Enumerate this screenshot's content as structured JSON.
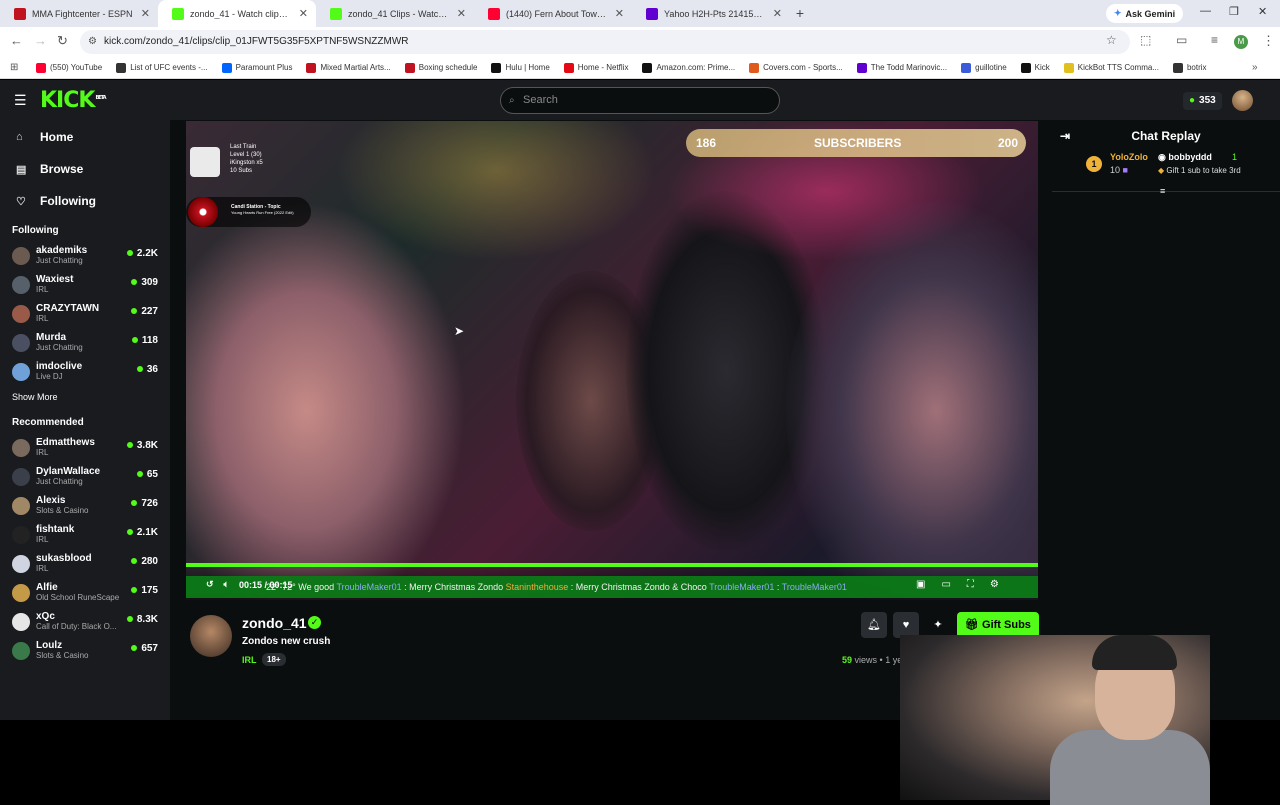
{
  "browser": {
    "tabs": [
      {
        "label": "MMA Fightcenter - ESPN",
        "color": "#c1121f",
        "active": false
      },
      {
        "label": "zondo_41 - Watch clips on Kick",
        "color": "#53fc18",
        "active": true
      },
      {
        "label": "zondo_41 Clips - Watch Live on",
        "color": "#53fc18",
        "active": false
      },
      {
        "label": "(1440) Fern About Town - YouTu",
        "color": "#ff0033",
        "active": false
      },
      {
        "label": "Yahoo H2H-Pts 214155 - Mr. Bo",
        "color": "#6001d2",
        "active": false
      }
    ],
    "gemini_label": "Ask Gemini",
    "url": "kick.com/zondo_41/clips/clip_01JFWT5G35F5XPTNF5WSNZZMWR",
    "bookmarks": [
      {
        "label": "(550) YouTube",
        "color": "#ff0033"
      },
      {
        "label": "List of UFC events -...",
        "color": "#333333"
      },
      {
        "label": "Paramount Plus",
        "color": "#0064ff"
      },
      {
        "label": "Mixed Martial Arts...",
        "color": "#c1121f"
      },
      {
        "label": "Boxing schedule",
        "color": "#c1121f"
      },
      {
        "label": "Hulu | Home",
        "color": "#111111"
      },
      {
        "label": "Home - Netflix",
        "color": "#e50914"
      },
      {
        "label": "Amazon.com: Prime...",
        "color": "#111111"
      },
      {
        "label": "Covers.com - Sports...",
        "color": "#e05a1c"
      },
      {
        "label": "The Todd Marinovic...",
        "color": "#6001d2"
      },
      {
        "label": "guillotine",
        "color": "#3b5bdb"
      },
      {
        "label": "Kick",
        "color": "#111111"
      },
      {
        "label": "KickBot TTS Comma...",
        "color": "#e0c020"
      },
      {
        "label": "botrix",
        "color": "#333333"
      }
    ]
  },
  "kick": {
    "logo": "KICK",
    "logo_beta": "BETA",
    "search_placeholder": "Search",
    "points": "353",
    "nav": [
      {
        "label": "Home",
        "icon": "home-icon",
        "glyph": "⌂"
      },
      {
        "label": "Browse",
        "icon": "browse-icon",
        "glyph": "▤"
      },
      {
        "label": "Following",
        "icon": "heart-icon",
        "glyph": "♡"
      }
    ],
    "following_header": "Following",
    "following": [
      {
        "name": "akademiks",
        "category": "Just Chatting",
        "viewers": "2.2K",
        "color": "#6b5a50"
      },
      {
        "name": "Waxiest",
        "category": "IRL",
        "viewers": "309",
        "color": "#55606a"
      },
      {
        "name": "CRAZYTAWN",
        "category": "IRL",
        "viewers": "227",
        "color": "#9a5a4a"
      },
      {
        "name": "Murda",
        "category": "Just Chatting",
        "viewers": "118",
        "color": "#4a4f62"
      },
      {
        "name": "imdoclive",
        "category": "Live DJ",
        "viewers": "36",
        "color": "#6fa1d8"
      }
    ],
    "show_more": "Show More",
    "recommended_header": "Recommended",
    "recommended": [
      {
        "name": "Edmatthews",
        "category": "IRL",
        "viewers": "3.8K",
        "color": "#7a6a5e"
      },
      {
        "name": "DylanWallace",
        "category": "Just Chatting",
        "viewers": "65",
        "color": "#3a3f4a"
      },
      {
        "name": "Alexis",
        "category": "Slots & Casino",
        "viewers": "726",
        "color": "#a08866"
      },
      {
        "name": "fishtank",
        "category": "IRL",
        "viewers": "2.1K",
        "color": "#222222"
      },
      {
        "name": "sukasblood",
        "category": "IRL",
        "viewers": "280",
        "color": "#d0d4e0"
      },
      {
        "name": "Alfie",
        "category": "Old School RuneScape",
        "viewers": "175",
        "color": "#c49a48"
      },
      {
        "name": "xQc",
        "category": "Call of Duty: Black O...",
        "viewers": "8.3K",
        "color": "#e6e6e6"
      },
      {
        "name": "Loulz",
        "category": "Slots & Casino",
        "viewers": "657",
        "color": "#3a7a4a"
      }
    ],
    "video": {
      "sub_goal_current": "186",
      "sub_goal_label": "SUBSCRIBERS",
      "sub_goal_target": "200",
      "train_title": "Last Train",
      "train_level": "Level 1 (30)",
      "train_user": "iKingston x5",
      "train_subs": "10 Subs",
      "song_title": "Candi Station - Topic",
      "song_sub": "Young Hearts Run Free (2022 Edit)",
      "time_current": "00:15",
      "time_total": "00:15",
      "progress": 1.0,
      "ticker": [
        {
          "type": "text",
          "text": "22° 72° "
        },
        {
          "type": "text",
          "text": "We good "
        },
        {
          "type": "user",
          "text": "TroubleMaker01"
        },
        {
          "type": "text",
          "text": " : Merry Christmas Zondo "
        },
        {
          "type": "gift",
          "text": "Staninthehouse"
        },
        {
          "type": "text",
          "text": " : Merry Christmas Zondo & Choco "
        },
        {
          "type": "user",
          "text": "TroubleMaker01"
        },
        {
          "type": "text",
          "text": " : "
        },
        {
          "type": "user",
          "text": "TroubleMaker01"
        }
      ]
    },
    "clip": {
      "channel": "zondo_41",
      "title": "Zondos new crush",
      "category": "IRL",
      "badge": "18+",
      "views": "59",
      "views_label": "views",
      "age": "1 year ago",
      "gift_subs_label": "Gift Subs"
    },
    "chat": {
      "title": "Chat Replay",
      "gift": {
        "rank": "1",
        "user": "YoloZolo",
        "count": "10",
        "recipient": "bobbyddd",
        "recipient_count": "1",
        "message": "Gift 1 sub to take 3rd"
      }
    }
  }
}
